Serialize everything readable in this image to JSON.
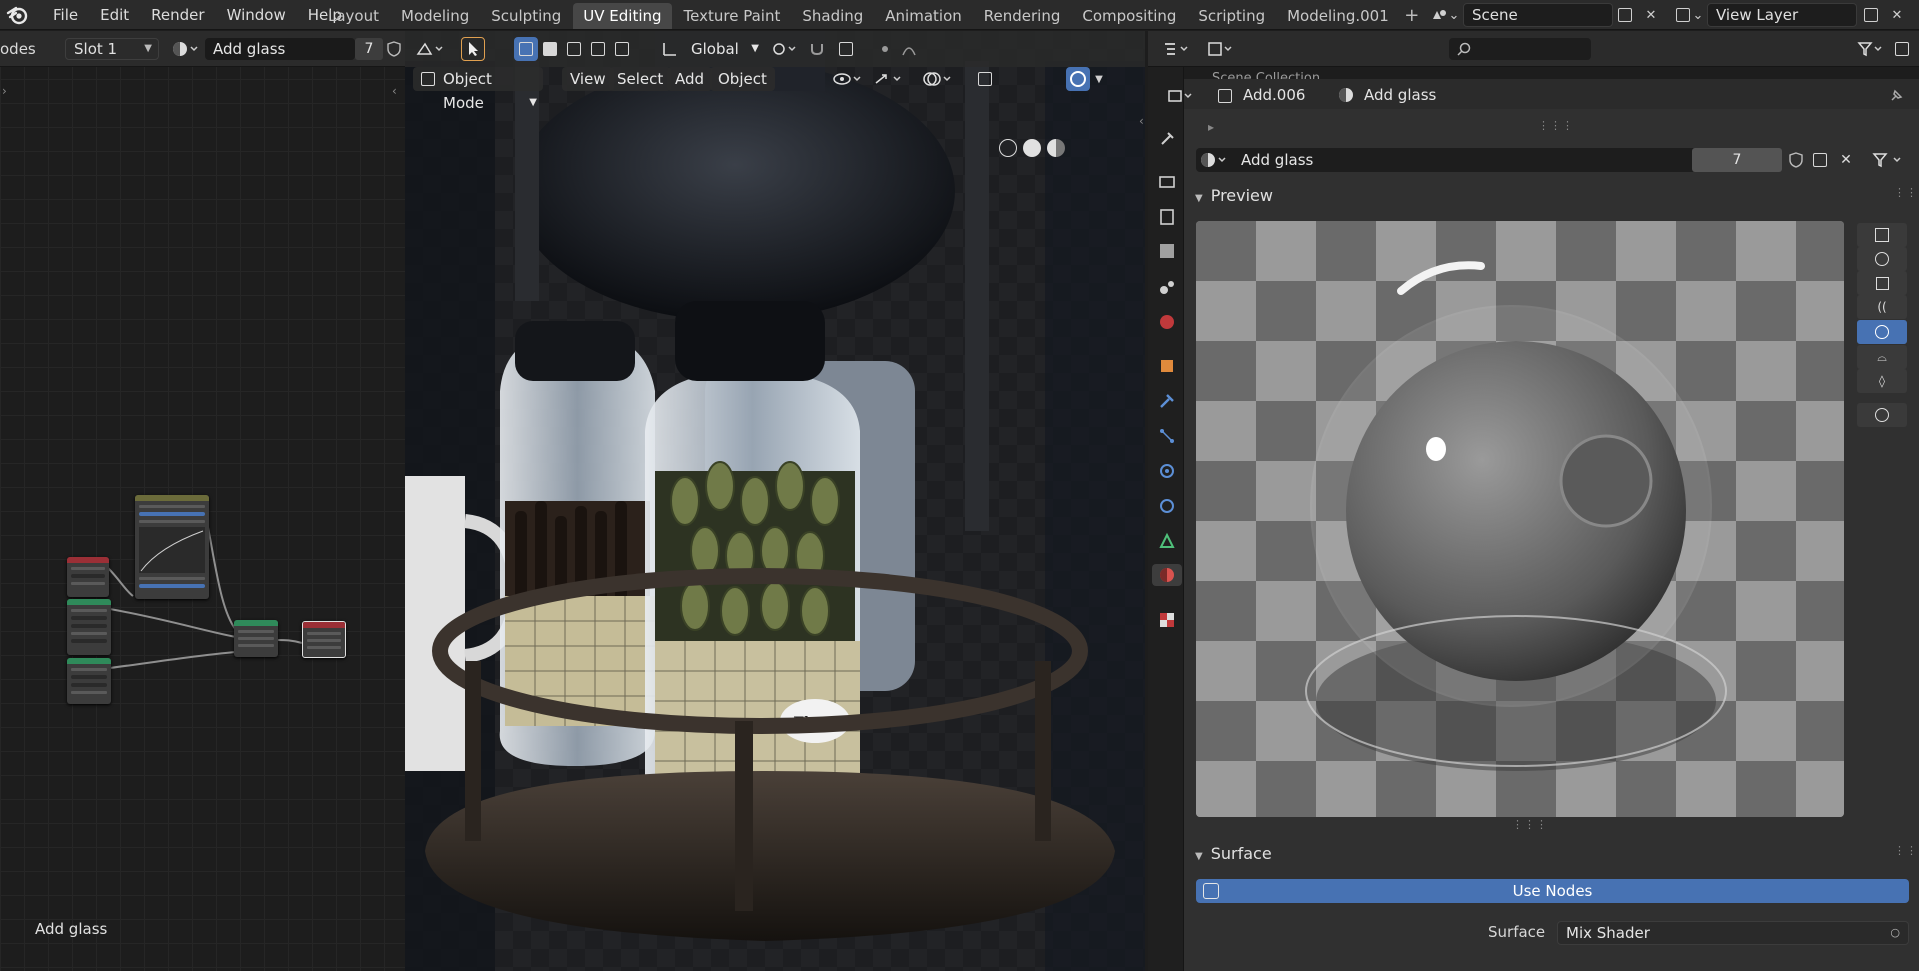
{
  "menu": [
    "File",
    "Edit",
    "Render",
    "Window",
    "Help"
  ],
  "workspaces": [
    {
      "label": "Layout",
      "active": false
    },
    {
      "label": "Modeling",
      "active": false
    },
    {
      "label": "Sculpting",
      "active": false
    },
    {
      "label": "UV Editing",
      "active": true
    },
    {
      "label": "Texture Paint",
      "active": false
    },
    {
      "label": "Shading",
      "active": false
    },
    {
      "label": "Animation",
      "active": false
    },
    {
      "label": "Rendering",
      "active": false
    },
    {
      "label": "Compositing",
      "active": false
    },
    {
      "label": "Scripting",
      "active": false
    },
    {
      "label": "Modeling.001",
      "active": false
    }
  ],
  "scene": "Scene",
  "view_layer": "View Layer",
  "node_editor": {
    "header_truncated_label": "odes",
    "slot": "Slot 1",
    "material": "Add glass",
    "user_count": "7",
    "footer_label": "Add glass"
  },
  "viewport": {
    "mode": "Object Mode",
    "menus": [
      "View",
      "Select",
      "Add",
      "Object"
    ],
    "orientation": "Global",
    "jar_label_text": "Flour"
  },
  "properties": {
    "object_name": "Add.006",
    "material_name": "Add glass",
    "slot_material": "Add glass",
    "users": "7",
    "collection_hint": "Scene Collection",
    "preview_title": "Preview",
    "surface_panel_title": "Surface",
    "use_nodes_label": "Use Nodes",
    "surface_label": "Surface",
    "surface_value": "Mix Shader"
  },
  "colors": {
    "accent": "#4772b3",
    "header_bg": "#2b2b2b",
    "panel_bg": "#303030",
    "node_editor_bg": "#1d1d1d"
  },
  "icons": {
    "blender_logo": "blender-logo-icon",
    "material": "material-sphere-icon",
    "search": "search-icon",
    "filter": "filter-icon"
  }
}
